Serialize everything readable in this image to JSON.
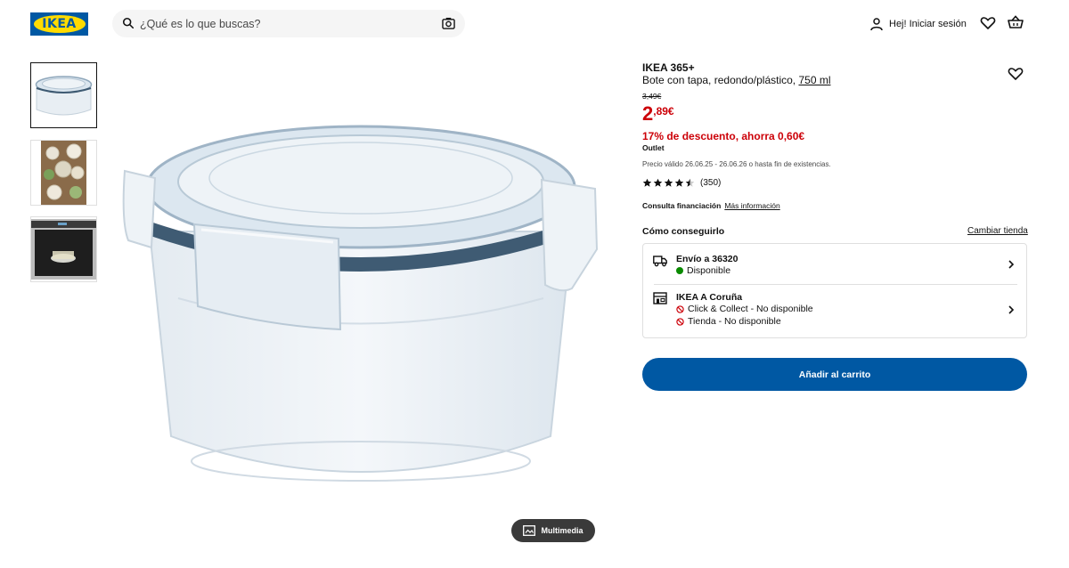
{
  "header": {
    "logo_text": "IKEA",
    "search_placeholder": "¿Qué es lo que buscas?",
    "login_label": "Hej! Iniciar sesión"
  },
  "gallery": {
    "multimedia_label": "Multimedia"
  },
  "product": {
    "brand": "IKEA 365+",
    "description": "Bote con tapa, redondo/plástico,",
    "size": "750 ml",
    "old_price": "3,49€",
    "price_int": "2",
    "price_dec": ",89€",
    "discount": "17% de descuento, ahorra 0,60€",
    "tag": "Outlet",
    "validity": "Precio válido 26.06.25 - 26.06.26 o hasta fin de existencias.",
    "rating_value": 4.5,
    "rating_count": "(350)",
    "financing_label": "Consulta financiación",
    "financing_link": "Más información"
  },
  "availability": {
    "heading": "Cómo conseguirlo",
    "change_store": "Cambiar tienda",
    "delivery_title": "Envío a 36320",
    "delivery_status": "Disponible",
    "store_title": "IKEA A Coruña",
    "click_collect": "Click & Collect - No disponible",
    "store_status": "Tienda - No disponible"
  },
  "actions": {
    "add_to_cart": "Añadir al carrito"
  },
  "colors": {
    "brand_blue": "#0058a3",
    "brand_yellow": "#ffdb00",
    "price_red": "#cc0008",
    "available_green": "#0a8a00"
  }
}
